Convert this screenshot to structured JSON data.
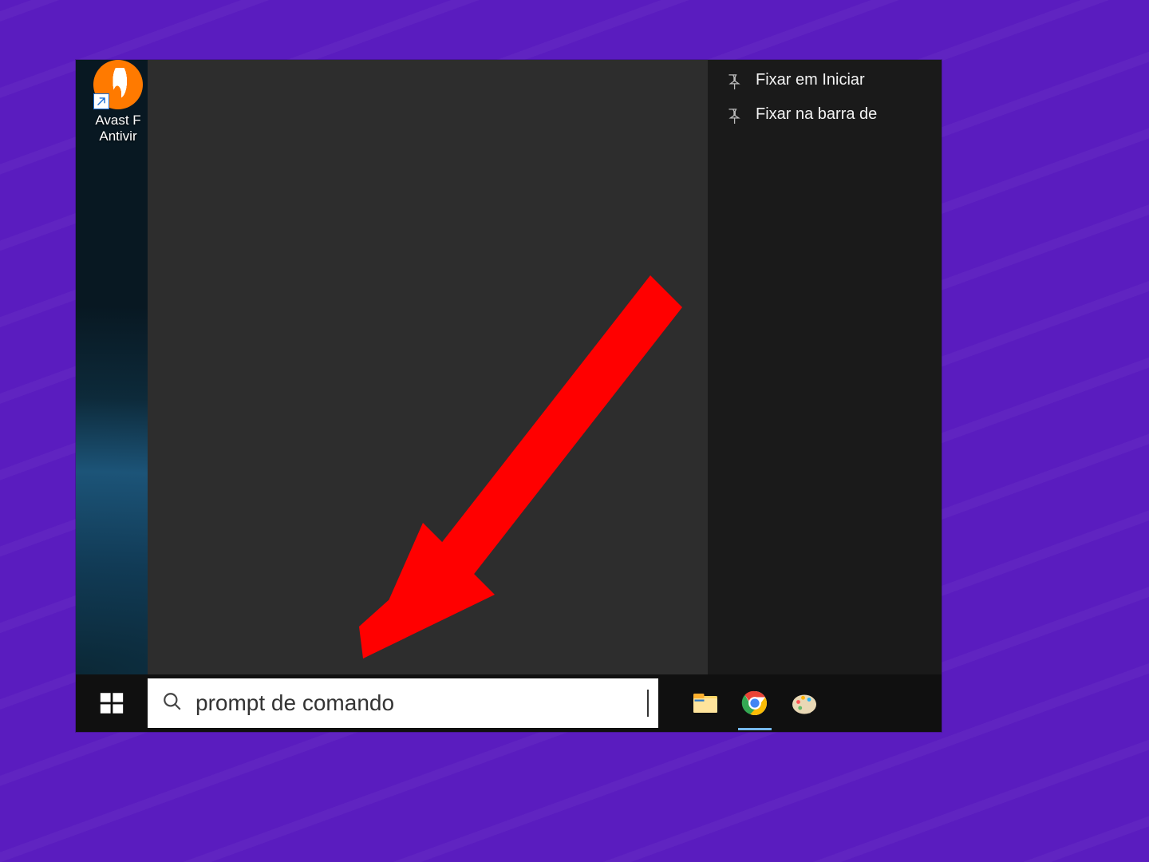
{
  "desktop": {
    "icon_label": "Avast F\nAntivir"
  },
  "start_side_panel": {
    "items": [
      {
        "label": "Fixar em Iniciar"
      },
      {
        "label": "Fixar na barra de"
      }
    ]
  },
  "taskbar": {
    "search_value": "prompt de comando",
    "search_placeholder": "",
    "apps": [
      {
        "name": "file-explorer"
      },
      {
        "name": "chrome"
      },
      {
        "name": "paint"
      }
    ]
  },
  "colors": {
    "page_bg": "#5a1cbf",
    "panel_dark": "#2d2d2d",
    "panel_darker": "#1a1a1a",
    "taskbar": "#101010",
    "annotation_arrow": "#ff0000"
  }
}
